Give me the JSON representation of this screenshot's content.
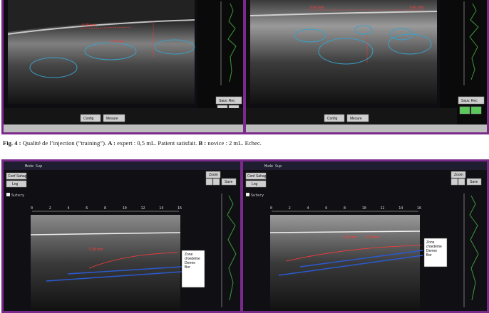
{
  "figure": {
    "caption_label": "Fig. 4 :",
    "caption_text": " Qualité de l’injection (“training”). ",
    "part_a": "A :",
    "part_a_text": " expert : 0,5 mL. Patient satisfait. ",
    "part_b": "B :",
    "part_b_text": " novice : 2 mL. Echec."
  },
  "top_panels": {
    "left": {
      "measure_labels": [
        "0.38 mm",
        "0.39 mm"
      ],
      "buttons": [
        "Config",
        "Mesure"
      ],
      "side_button": "Sauv. Rec"
    },
    "right": {
      "measure_labels": [
        "0.42 mm",
        "0.41 mm"
      ],
      "buttons": [
        "Config",
        "Mesure"
      ],
      "side_button": "Sauv. Rec"
    }
  },
  "bottom_panels": {
    "left": {
      "menu": "Mode Sup",
      "side_buttons": [
        "Conf Sahage",
        "Lng"
      ],
      "checkbox": "Sutery",
      "zoom_button": "Zoom",
      "save_button": "Save",
      "ruler": [
        "0",
        "2",
        "4",
        "6",
        "8",
        "10",
        "12",
        "14",
        "16"
      ],
      "legend": [
        "Zone",
        "d'oedème",
        "Derme",
        "Bor"
      ],
      "measure_labels": [
        "0.38 mm"
      ]
    },
    "right": {
      "menu": "Mode Sup",
      "side_buttons": [
        "Conf Sahage",
        "Lng"
      ],
      "checkbox": "Sutery",
      "zoom_button": "Zoom",
      "save_button": "Save",
      "ruler": [
        "0",
        "2",
        "4",
        "6",
        "8",
        "10",
        "12",
        "14",
        "16"
      ],
      "legend": [
        "Zone",
        "d'oedème",
        "Derme",
        "Bor"
      ],
      "measure_labels": [
        "0.38 mm",
        "0.38 mm"
      ]
    }
  },
  "colors": {
    "frame": "#7a2a8a",
    "contour": "#3aa0c8",
    "measure": "#ff3a3a",
    "trace": "#3a9a3a"
  }
}
